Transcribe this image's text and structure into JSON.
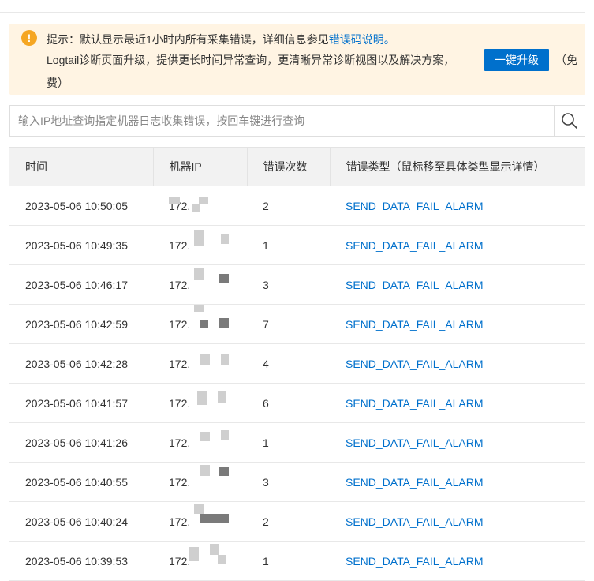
{
  "notice": {
    "line1_prefix": "提示：默认显示最近1小时内所有采集错误，详细信息参见",
    "link": "错误码说明。",
    "line2": "Logtail诊断页面升级，提供更长时间异常查询，更清晰异常诊断视图以及解决方案，",
    "upgrade_button": "一键升级",
    "line2_suffix": "（免",
    "line3": "费）",
    "colors": {
      "background": "#fff4e3",
      "icon": "#f5a623",
      "accent": "#0070cc"
    }
  },
  "search": {
    "placeholder": "输入IP地址查询指定机器日志收集错误，按回车键进行查询",
    "value": "",
    "icon": "search-icon"
  },
  "table": {
    "headers": [
      "时间",
      "机器IP",
      "错误次数",
      "错误类型（鼠标移至具体类型显示详情）"
    ],
    "rows": [
      {
        "time": "2023-05-06 10:50:05",
        "ip": "172.",
        "count": "2",
        "type": "SEND_DATA_FAIL_ALARM"
      },
      {
        "time": "2023-05-06 10:49:35",
        "ip": "172.",
        "count": "1",
        "type": "SEND_DATA_FAIL_ALARM"
      },
      {
        "time": "2023-05-06 10:46:17",
        "ip": "172.",
        "count": "3",
        "type": "SEND_DATA_FAIL_ALARM"
      },
      {
        "time": "2023-05-06 10:42:59",
        "ip": "172.",
        "count": "7",
        "type": "SEND_DATA_FAIL_ALARM"
      },
      {
        "time": "2023-05-06 10:42:28",
        "ip": "172.",
        "count": "4",
        "type": "SEND_DATA_FAIL_ALARM"
      },
      {
        "time": "2023-05-06 10:41:57",
        "ip": "172.",
        "count": "6",
        "type": "SEND_DATA_FAIL_ALARM"
      },
      {
        "time": "2023-05-06 10:41:26",
        "ip": "172.",
        "count": "1",
        "type": "SEND_DATA_FAIL_ALARM"
      },
      {
        "time": "2023-05-06 10:40:55",
        "ip": "172.",
        "count": "3",
        "type": "SEND_DATA_FAIL_ALARM"
      },
      {
        "time": "2023-05-06 10:40:24",
        "ip": "172.",
        "count": "2",
        "type": "SEND_DATA_FAIL_ALARM"
      },
      {
        "time": "2023-05-06 10:39:53",
        "ip": "172.",
        "count": "1",
        "type": "SEND_DATA_FAIL_ALARM"
      }
    ]
  }
}
